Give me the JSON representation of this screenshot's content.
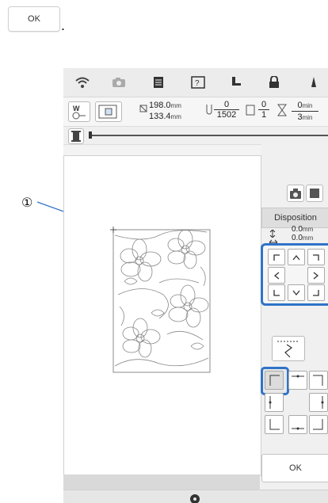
{
  "instruction": {
    "ok_button_label": "OK",
    "trailing_dot": "."
  },
  "callout": {
    "marker": "①"
  },
  "machine": {
    "status_icons": [
      "wifi-icon",
      "camera-icon",
      "document-icon",
      "help-icon",
      "presser-foot-icon",
      "lock-icon",
      "needle-icon"
    ],
    "pattern": {
      "width_value": "198.0",
      "height_value": "133.4",
      "unit": "mm",
      "stitch_current": "0",
      "stitch_total": "1502",
      "color_current": "0",
      "color_total": "1",
      "time_current": "0",
      "time_unit": "min",
      "time_total": "3",
      "time_total_unit": "min"
    },
    "panel": {
      "disposition_label": "Disposition",
      "offset_v": "0.0",
      "offset_h": "0.0",
      "unit": "mm",
      "ok_label": "OK"
    },
    "colors": {
      "highlight": "#2f73c9"
    }
  }
}
